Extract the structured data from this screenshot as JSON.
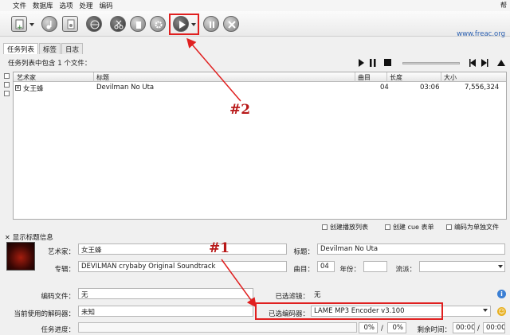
{
  "menu": {
    "items": [
      "文件",
      "数据库",
      "选项",
      "处理",
      "编码"
    ],
    "right": "帮"
  },
  "toolbar": {
    "url": "www.freac.org"
  },
  "tabs": [
    "任务列表",
    "标签",
    "日志"
  ],
  "job_list": {
    "summary": "任务列表中包含 1 个文件：",
    "columns": [
      "艺术家",
      "标题",
      "曲目",
      "长度",
      "大小"
    ],
    "rows": [
      {
        "artist": "女王蜂",
        "title": "Devilman No Uta",
        "track": "04",
        "length": "03:06",
        "size": "7,556,324"
      }
    ]
  },
  "options": {
    "create_playlist": "创建播放列表",
    "create_cue": "创建 cue 表单",
    "encode_single": "编码为单独文件"
  },
  "tag_panel": {
    "toggle_label": "显示标题信息",
    "artist_label": "艺术家：",
    "artist_value": "女王蜂",
    "title_label": "标题：",
    "title_value": "Devilman No Uta",
    "album_label": "专辑：",
    "album_value": "DEVILMAN crybaby Original Soundtrack",
    "track_label": "曲目：",
    "track_value": "04",
    "year_label": "年份：",
    "genre_label": "流派："
  },
  "status": {
    "encode_file_label": "编码文件：",
    "encode_file_value": "无",
    "filter_label": "已选滤镜：",
    "filter_value": "无",
    "decoder_label": "当前使用的解码器：",
    "decoder_value": "未知",
    "encoder_label": "已选编码器：",
    "encoder_value": "LAME MP3 Encoder v3.100",
    "progress_label": "任务进度：",
    "pct1": "0%",
    "pct_sep": "/",
    "pct2": "0%",
    "remaining_label": "剩余时间：",
    "time1": "00:00",
    "time_sep": "/",
    "time2": "00:00"
  },
  "annotations": {
    "a1": "#1",
    "a2": "#2"
  },
  "colors": {
    "highlight": "#e02020",
    "annotation": "#b81818",
    "link": "#2a5fb0"
  }
}
